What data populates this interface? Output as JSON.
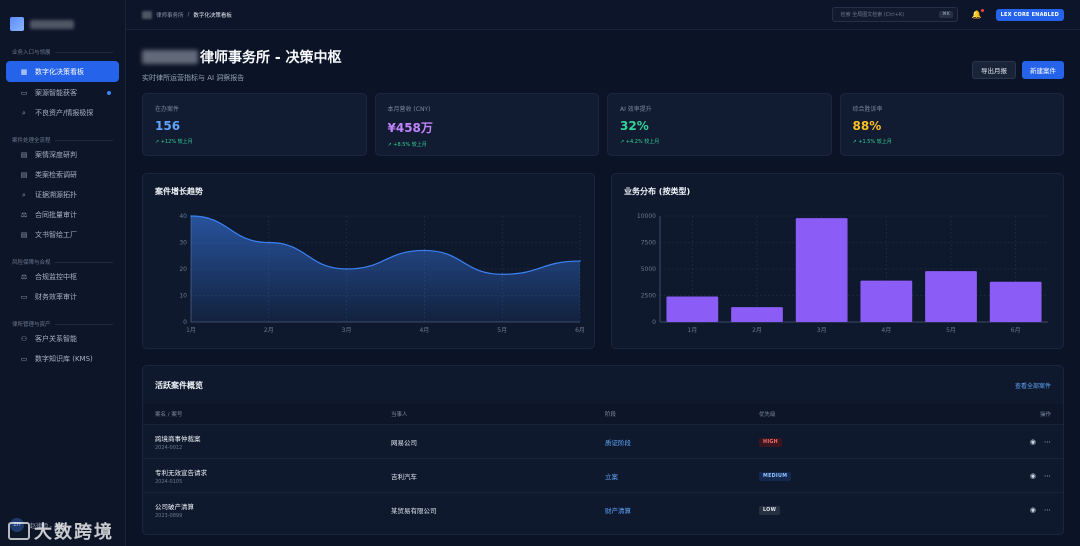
{
  "sidebar": {
    "sections": [
      {
        "title": "业务入口与领展",
        "items": [
          {
            "label": "数字化决策看板",
            "icon": "grid-icon",
            "active": true
          },
          {
            "label": "案源智能获客",
            "icon": "chat-icon",
            "dot": true
          },
          {
            "label": "不良资产/情报极探",
            "icon": "search-icon"
          }
        ]
      },
      {
        "title": "案件处理全流程",
        "items": [
          {
            "label": "案情深度研判",
            "icon": "document-icon"
          },
          {
            "label": "类案检索调研",
            "icon": "document-icon"
          },
          {
            "label": "证据溯源拓扑",
            "icon": "search-icon"
          },
          {
            "label": "合同批量审计",
            "icon": "scale-icon"
          },
          {
            "label": "文书智绘工厂",
            "icon": "document-icon"
          }
        ]
      },
      {
        "title": "风险保障与合规",
        "items": [
          {
            "label": "合规监控中枢",
            "icon": "scale-icon"
          },
          {
            "label": "财务效率审计",
            "icon": "folder-icon"
          }
        ]
      },
      {
        "title": "律所管理与资产",
        "items": [
          {
            "label": "客户关系智能",
            "icon": "users-icon"
          },
          {
            "label": "数字知识库 (KMS)",
            "icon": "folder-icon"
          }
        ]
      }
    ],
    "footer_avatar": "ZH",
    "footer_user": "赵律师 - 主任",
    "watermark": "大数跨境"
  },
  "topbar": {
    "crumb_parent": "律师事务所",
    "crumb_current": "数字化决策看板",
    "search_placeholder": "检索 全局图文检索 (Ctrl+K)",
    "search_kbd": "⌘K",
    "core_badge": "LEX CORE ENABLED"
  },
  "hero": {
    "title": "律师事务所 - 决策中枢",
    "subtitle": "实时律所运营指标与 AI 洞察报告",
    "export_label": "导出月报",
    "new_label": "新建案件"
  },
  "kpis": [
    {
      "label": "在办案件",
      "value": "156",
      "change": "+12% 较上月",
      "color": "#60a5fa"
    },
    {
      "label": "本月营收 (CNY)",
      "value": "¥458万",
      "change": "+8.5% 较上月",
      "color": "#c084fc"
    },
    {
      "label": "AI 效率提升",
      "value": "32%",
      "change": "+4.2% 较上月",
      "color": "#34d399"
    },
    {
      "label": "综合胜诉率",
      "value": "88%",
      "change": "+1.5% 较上月",
      "color": "#fbbf24"
    }
  ],
  "chart_data": [
    {
      "type": "area",
      "title": "案件增长趋势",
      "categories": [
        "1月",
        "2月",
        "3月",
        "4月",
        "5月",
        "6月"
      ],
      "values": [
        40,
        30,
        20,
        27,
        18,
        23
      ],
      "ylim": [
        0,
        40
      ],
      "yticks": [
        0,
        10,
        20,
        30,
        40
      ],
      "grid": true,
      "color": "#3b82f6"
    },
    {
      "type": "bar",
      "title": "业务分布 (按类型)",
      "categories": [
        "1月",
        "2月",
        "3月",
        "4月",
        "5月",
        "6月"
      ],
      "values": [
        2400,
        1400,
        9800,
        3900,
        4800,
        3800
      ],
      "ylim": [
        0,
        10000
      ],
      "yticks": [
        0,
        2500,
        5000,
        7500,
        10000
      ],
      "grid": true,
      "color": "#8b5cf6"
    }
  ],
  "table": {
    "title": "活跃案件概览",
    "view_all": "查看全部案件",
    "headers": [
      "案名 / 案号",
      "当事人",
      "阶段",
      "优先级",
      "操作"
    ],
    "rows": [
      {
        "name": "跨境商事仲裁案",
        "id": "2024-0012",
        "party": "网易公司",
        "stage": "质证阶段",
        "priority": "HIGH",
        "level": "high"
      },
      {
        "name": "专利无效宣告请求",
        "id": "2024-0105",
        "party": "吉利汽车",
        "stage": "立案",
        "priority": "MEDIUM",
        "level": "medium"
      },
      {
        "name": "公司破产清算",
        "id": "2023-0899",
        "party": "某贸易有限公司",
        "stage": "财产清算",
        "priority": "LOW",
        "level": "low"
      }
    ]
  }
}
